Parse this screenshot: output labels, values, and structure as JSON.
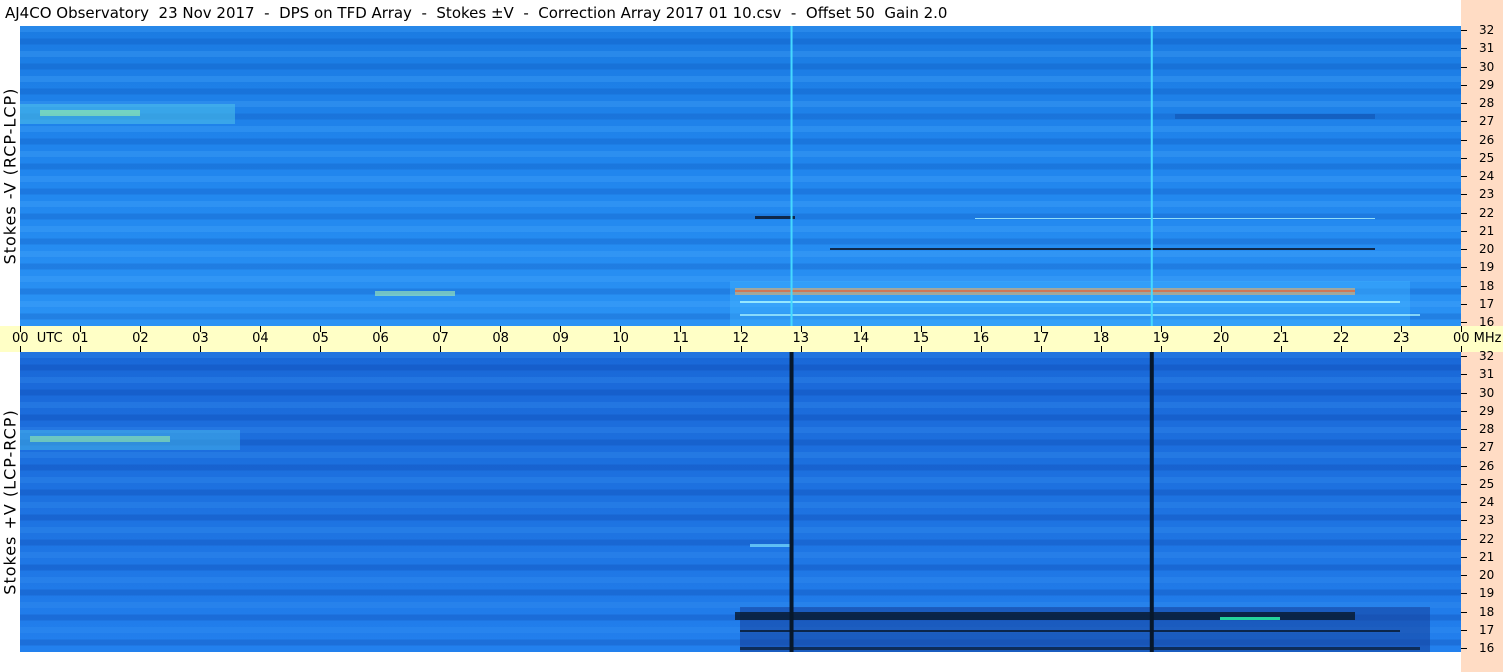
{
  "title": "AJ4CO Observatory  23 Nov 2017  -  DPS on TFD Array  -  Stokes ±V  -  Correction Array 2017 01 10.csv  -  Offset 50  Gain 2.0",
  "panels": {
    "top": {
      "label": "Stokes -V (RCP-LCP)",
      "background": "#1f7fe6",
      "interference_color": "#45d8ff",
      "highlight_color": "#ffb45a"
    },
    "bottom": {
      "label": "Stokes +V (LCP-RCP)",
      "background": "#1860d8",
      "interference_color": "#07182c",
      "highlight_color": "#2bffb4"
    }
  },
  "time_axis": {
    "labels": [
      "00",
      "01",
      "02",
      "03",
      "04",
      "05",
      "06",
      "07",
      "08",
      "09",
      "10",
      "11",
      "12",
      "13",
      "14",
      "15",
      "16",
      "17",
      "18",
      "19",
      "20",
      "21",
      "22",
      "23",
      "00"
    ],
    "start_unit": "UTC",
    "end_unit": "MHz"
  },
  "freq_axis": {
    "labels": [
      "32",
      "31",
      "30",
      "29",
      "28",
      "27",
      "26",
      "25",
      "24",
      "23",
      "22",
      "21",
      "20",
      "19",
      "18",
      "17",
      "16"
    ],
    "min": 16,
    "max": 32
  },
  "colors": {
    "time_axis_bg": "#ffffc6",
    "freq_axis_bg": "#ffdcc4"
  },
  "interference_lines_utc": [
    12.85,
    18.85
  ]
}
